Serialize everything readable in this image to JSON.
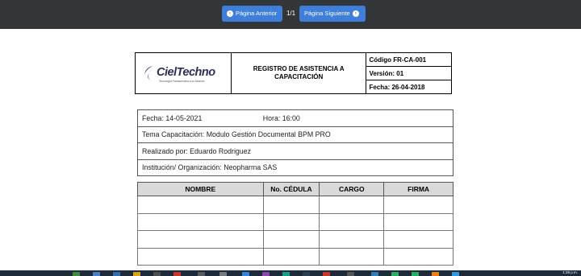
{
  "toolbar": {
    "prev_label": "Página Anterior",
    "next_label": "Página Siguiente",
    "page_count": "1/1",
    "prev_icon": "arrow-left-circle-icon",
    "next_icon": "arrow-right-circle-icon"
  },
  "header": {
    "logo_text": "CielTechno",
    "logo_tagline": "Tecnología Farmacéutica a su Alcance",
    "title": "REGISTRO DE ASISTENCIA A CAPACITACIÓN",
    "codigo": "Código FR-CA-001",
    "version": "Versión: 01",
    "fecha": "Fecha: 26-04-2018"
  },
  "info": {
    "fecha": "Fecha: 14-05-2021",
    "hora": "Hora:  16:00",
    "tema": "Tema Capacitación: Modulo Gestión Documental BPM PRO",
    "realizado": "Realizado por: Eduardo Rodriguez",
    "institucion": "Institución/ Organización: Neopharma SAS"
  },
  "table": {
    "columns": [
      "NOMBRE",
      "No. CÉDULA",
      "CARGO",
      "FIRMA"
    ]
  },
  "taskbar": {
    "time": "1:28 p.m."
  },
  "colors": {
    "toolbar_bg": "#323639",
    "button_bg": "#3f7fd9",
    "table_header_bg": "#d9d9d9",
    "taskbar_bg": "#1c2a3a"
  }
}
